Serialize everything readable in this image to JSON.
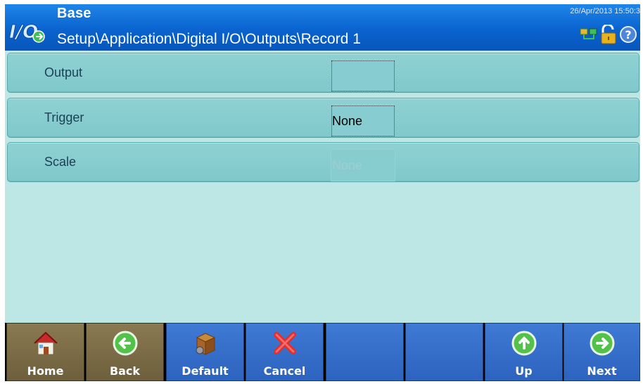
{
  "header": {
    "title": "Base",
    "path": "Setup\\Application\\Digital I/O\\Outputs\\Record 1",
    "datetime": "26/Apr/2013 15:50:3",
    "logo_icon": "io-icon",
    "status_icons": [
      "network-icon",
      "lock-icon",
      "help-icon"
    ]
  },
  "rows": [
    {
      "label": "Output",
      "value": ""
    },
    {
      "label": "Trigger",
      "value": "None"
    },
    {
      "label": "Scale",
      "value": "None"
    }
  ],
  "toolbar": [
    {
      "label": "Home",
      "icon": "home-icon"
    },
    {
      "label": "Back",
      "icon": "back-arrow-icon"
    },
    {
      "label": "Default",
      "icon": "default-box-icon"
    },
    {
      "label": "Cancel",
      "icon": "cancel-x-icon"
    },
    {
      "label": "",
      "icon": ""
    },
    {
      "label": "",
      "icon": ""
    },
    {
      "label": "Up",
      "icon": "up-arrow-icon"
    },
    {
      "label": "Next",
      "icon": "next-arrow-icon"
    }
  ],
  "colors": {
    "header_blue": "#0a63cf",
    "content_bg": "#bce7e4",
    "row_bg": "#8fd1d3",
    "toolbar_blue": "#2c63be",
    "toolbar_brown": "#6d5f3c"
  }
}
